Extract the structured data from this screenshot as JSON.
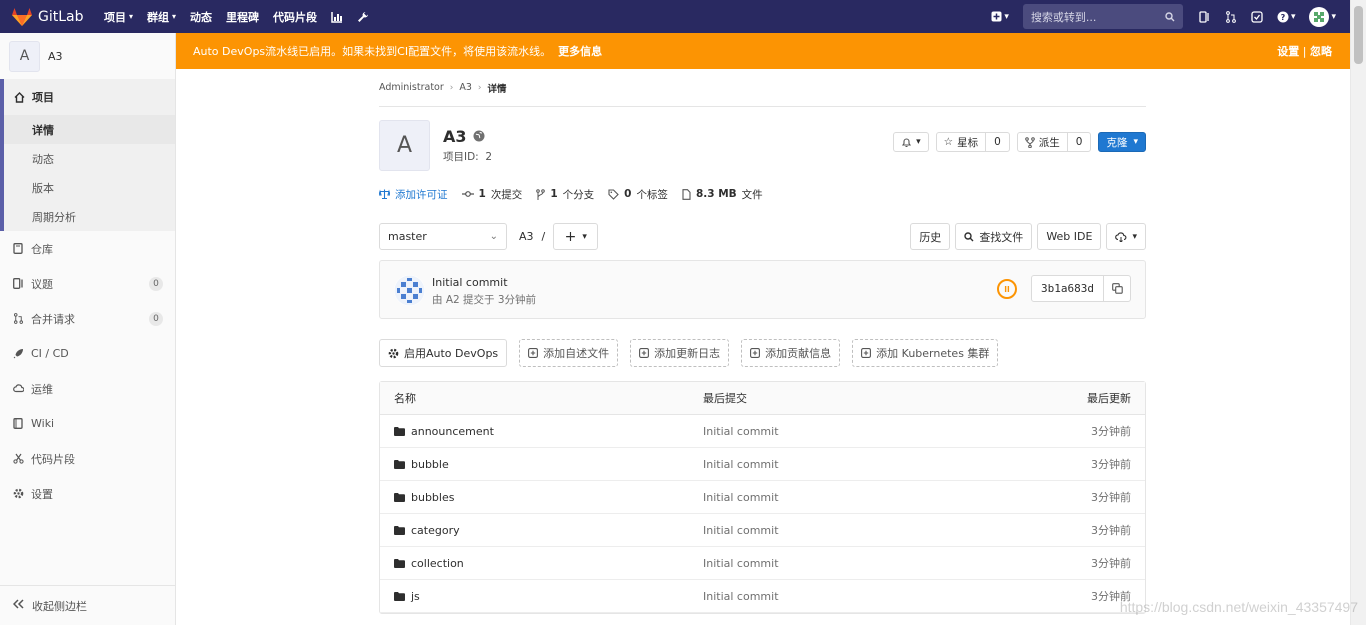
{
  "navbar": {
    "brand": "GitLab",
    "links": [
      {
        "label": "项目",
        "has_caret": true
      },
      {
        "label": "群组",
        "has_caret": true
      },
      {
        "label": "动态",
        "has_caret": false
      },
      {
        "label": "里程碑",
        "has_caret": false
      },
      {
        "label": "代码片段",
        "has_caret": false
      }
    ],
    "search_placeholder": "搜索或转到...",
    "brand_color": "#292961"
  },
  "sidebar": {
    "project_initial": "A",
    "project_name": "A3",
    "project_section": {
      "label": "项目",
      "sub_items": [
        {
          "label": "详情",
          "active": true
        },
        {
          "label": "动态",
          "active": false
        },
        {
          "label": "版本",
          "active": false
        },
        {
          "label": "周期分析",
          "active": false
        }
      ]
    },
    "items": [
      {
        "label": "仓库",
        "icon": "book-icon"
      },
      {
        "label": "议题",
        "icon": "issues-icon",
        "badge": "0"
      },
      {
        "label": "合并请求",
        "icon": "merge-request-icon",
        "badge": "0"
      },
      {
        "label": "CI / CD",
        "icon": "rocket-icon"
      },
      {
        "label": "运维",
        "icon": "cloud-gear-icon"
      },
      {
        "label": "Wiki",
        "icon": "book-open-icon"
      },
      {
        "label": "代码片段",
        "icon": "scissors-icon"
      },
      {
        "label": "设置",
        "icon": "gear-icon"
      }
    ],
    "collapse_label": "收起侧边栏"
  },
  "banner": {
    "text": "Auto DevOps流水线已启用。如果未找到CI配置文件，将使用该流水线。",
    "more": "更多信息",
    "settings": "设置",
    "divider": "|",
    "dismiss": "忽略",
    "color": "#fc9403"
  },
  "breadcrumb": [
    "Administrator",
    "A3",
    "详情"
  ],
  "project": {
    "initial": "A",
    "title": "A3",
    "id_label": "项目ID:",
    "id_value": "2",
    "star_label": "星标",
    "star_count": "0",
    "fork_label": "派生",
    "fork_count": "0",
    "clone_label": "克隆"
  },
  "stats": {
    "license": "添加许可证",
    "commits_count": "1",
    "commits_label": "次提交",
    "branches_count": "1",
    "branches_label": "个分支",
    "tags_count": "0",
    "tags_label": "个标签",
    "size": "8.3 MB",
    "size_label": "文件"
  },
  "toolbar": {
    "branch": "master",
    "path_root": "A3",
    "path_sep": "/",
    "history": "历史",
    "find_file": "查找文件",
    "web_ide": "Web IDE"
  },
  "commit": {
    "title": "Initial commit",
    "meta": "由 A2 提交于 3分钟前",
    "sha": "3b1a683d"
  },
  "quick_actions": [
    {
      "label": "启用Auto DevOps",
      "icon": "gear-icon",
      "solid": true
    },
    {
      "label": "添加自述文件",
      "icon": "plus-square-icon",
      "solid": false
    },
    {
      "label": "添加更新日志",
      "icon": "plus-square-icon",
      "solid": false
    },
    {
      "label": "添加贡献信息",
      "icon": "plus-square-icon",
      "solid": false
    },
    {
      "label": "添加 Kubernetes 集群",
      "icon": "plus-square-icon",
      "solid": false
    }
  ],
  "file_table": {
    "headers": {
      "name": "名称",
      "last_commit": "最后提交",
      "last_update": "最后更新"
    },
    "rows": [
      {
        "name": "announcement",
        "commit": "Initial commit",
        "date": "3分钟前"
      },
      {
        "name": "bubble",
        "commit": "Initial commit",
        "date": "3分钟前"
      },
      {
        "name": "bubbles",
        "commit": "Initial commit",
        "date": "3分钟前"
      },
      {
        "name": "category",
        "commit": "Initial commit",
        "date": "3分钟前"
      },
      {
        "name": "collection",
        "commit": "Initial commit",
        "date": "3分钟前"
      },
      {
        "name": "js",
        "commit": "Initial commit",
        "date": "3分钟前"
      }
    ]
  },
  "watermark": "https://blog.csdn.net/weixin_43357497"
}
